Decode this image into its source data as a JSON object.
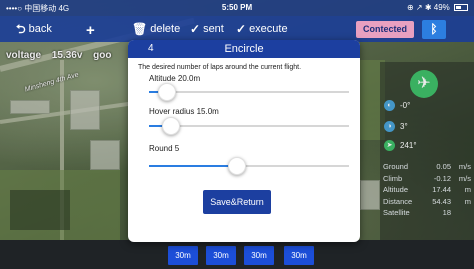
{
  "status_bar": {
    "carrier": "••••○ 中国移动 4G",
    "time": "5:50 PM",
    "right": "⊕ ↗ ✱ 49%"
  },
  "toolbar": {
    "back_label": "back",
    "delete_label": "delete",
    "sent_label": "sent",
    "execute_label": "execute",
    "connected_label": "Contected",
    "bluetooth_icon": "bluetooth-icon"
  },
  "map": {
    "voltage_label": "voltage",
    "voltage_value": "15.36v",
    "voltage_extra": "goo",
    "street_label": "Minsheng 4th Ave"
  },
  "attitude": {
    "roll": "-0°",
    "pitch": "3°",
    "heading": "241°"
  },
  "telemetry": [
    {
      "key": "Ground",
      "value": "0.05",
      "unit": "m/s"
    },
    {
      "key": "Climb",
      "value": "-0.12",
      "unit": "m/s"
    },
    {
      "key": "Altitude",
      "value": "17.44",
      "unit": "m"
    },
    {
      "key": "Distance",
      "value": "54.43",
      "unit": "m"
    },
    {
      "key": "Satellite",
      "value": "18",
      "unit": ""
    }
  ],
  "bottom_buttons": [
    "30m",
    "30m",
    "30m",
    "30m"
  ],
  "modal": {
    "number": "4",
    "title": "Encircle",
    "description": "The desired number of laps around the current flight.",
    "sliders": [
      {
        "label": "Altitude 20.0m",
        "fraction": 0.09
      },
      {
        "label": "Hover radius 15.0m",
        "fraction": 0.11
      },
      {
        "label": "Round 5",
        "fraction": 0.44
      }
    ],
    "save_label": "Save&Return"
  },
  "colors": {
    "bar_blue": "#1c3fa0",
    "slider_blue": "#2a7de1",
    "connected_pink": "#e8a0c0",
    "plane_green": "#3fbf6a"
  }
}
